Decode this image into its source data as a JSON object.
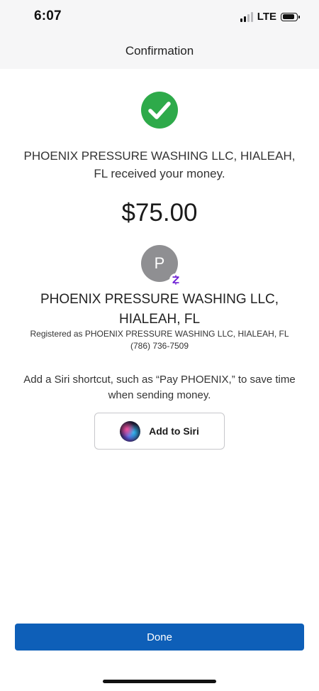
{
  "status_bar": {
    "time": "6:07",
    "network": "LTE",
    "signal_bars_filled": 2,
    "signal_bars_total": 4,
    "battery_level": 0.85
  },
  "nav": {
    "title": "Confirmation"
  },
  "confirmation": {
    "icon": "check-circle-icon",
    "success_color": "#2eaa4a",
    "message": "PHOENIX PRESSURE WASHING LLC, HIALEAH, FL received your money.",
    "amount": "$75.00"
  },
  "recipient": {
    "initial": "P",
    "badge_icon": "zelle-icon",
    "badge_color": "#6d1ed4",
    "name": "PHOENIX PRESSURE WASHING LLC, HIALEAH, FL",
    "registered": "Registered as PHOENIX PRESSURE WASHING LLC, HIALEAH, FL",
    "phone": "(786) 736-7509"
  },
  "siri": {
    "text": "Add a Siri shortcut, such as “Pay PHOENIX,” to save time when sending money.",
    "button_label": "Add to Siri",
    "icon": "siri-icon"
  },
  "actions": {
    "done_label": "Done",
    "accent_color": "#0e5fb8"
  }
}
